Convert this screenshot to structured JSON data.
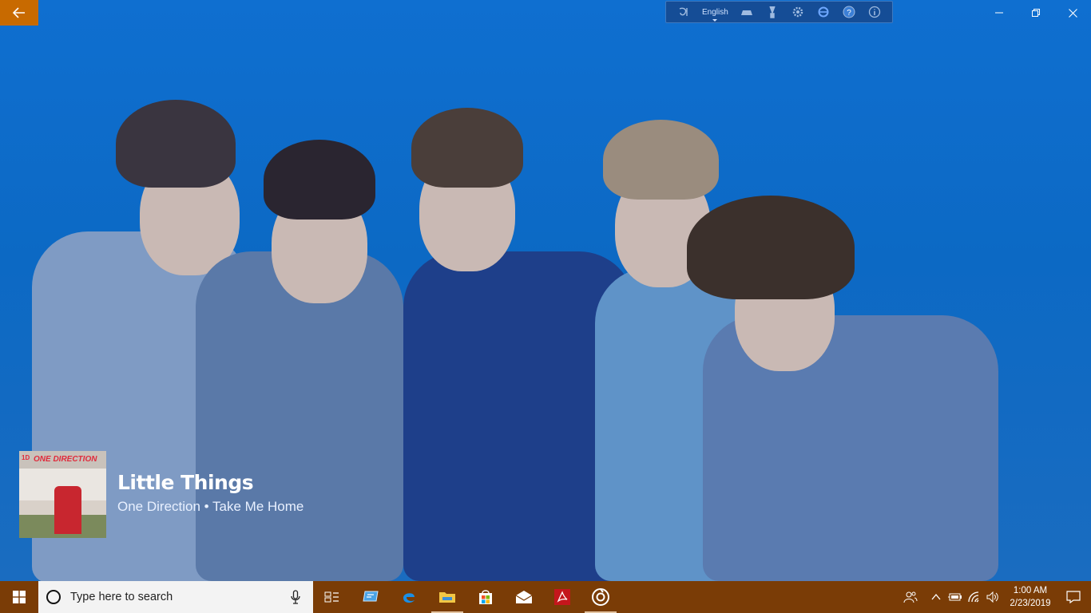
{
  "app": {
    "back_label": "←"
  },
  "language_bar": {
    "language": "English"
  },
  "now_playing": {
    "title": "Little Things",
    "subtitle": "One Direction • Take Me Home",
    "album_art_text": "ONE DIRECTION",
    "album_art_badge": "1D"
  },
  "taskbar": {
    "search_placeholder": "Type here to search",
    "pinned_apps": [
      "task-view",
      "remote-desktop",
      "edge",
      "file-explorer",
      "store",
      "mail",
      "acrobat",
      "groove-music"
    ]
  },
  "clock": {
    "time": "1:00 AM",
    "date": "2/23/2019"
  },
  "colors": {
    "accent": "#c86a00",
    "taskbar": "#7a3c06",
    "background": "#0d6ac7"
  }
}
